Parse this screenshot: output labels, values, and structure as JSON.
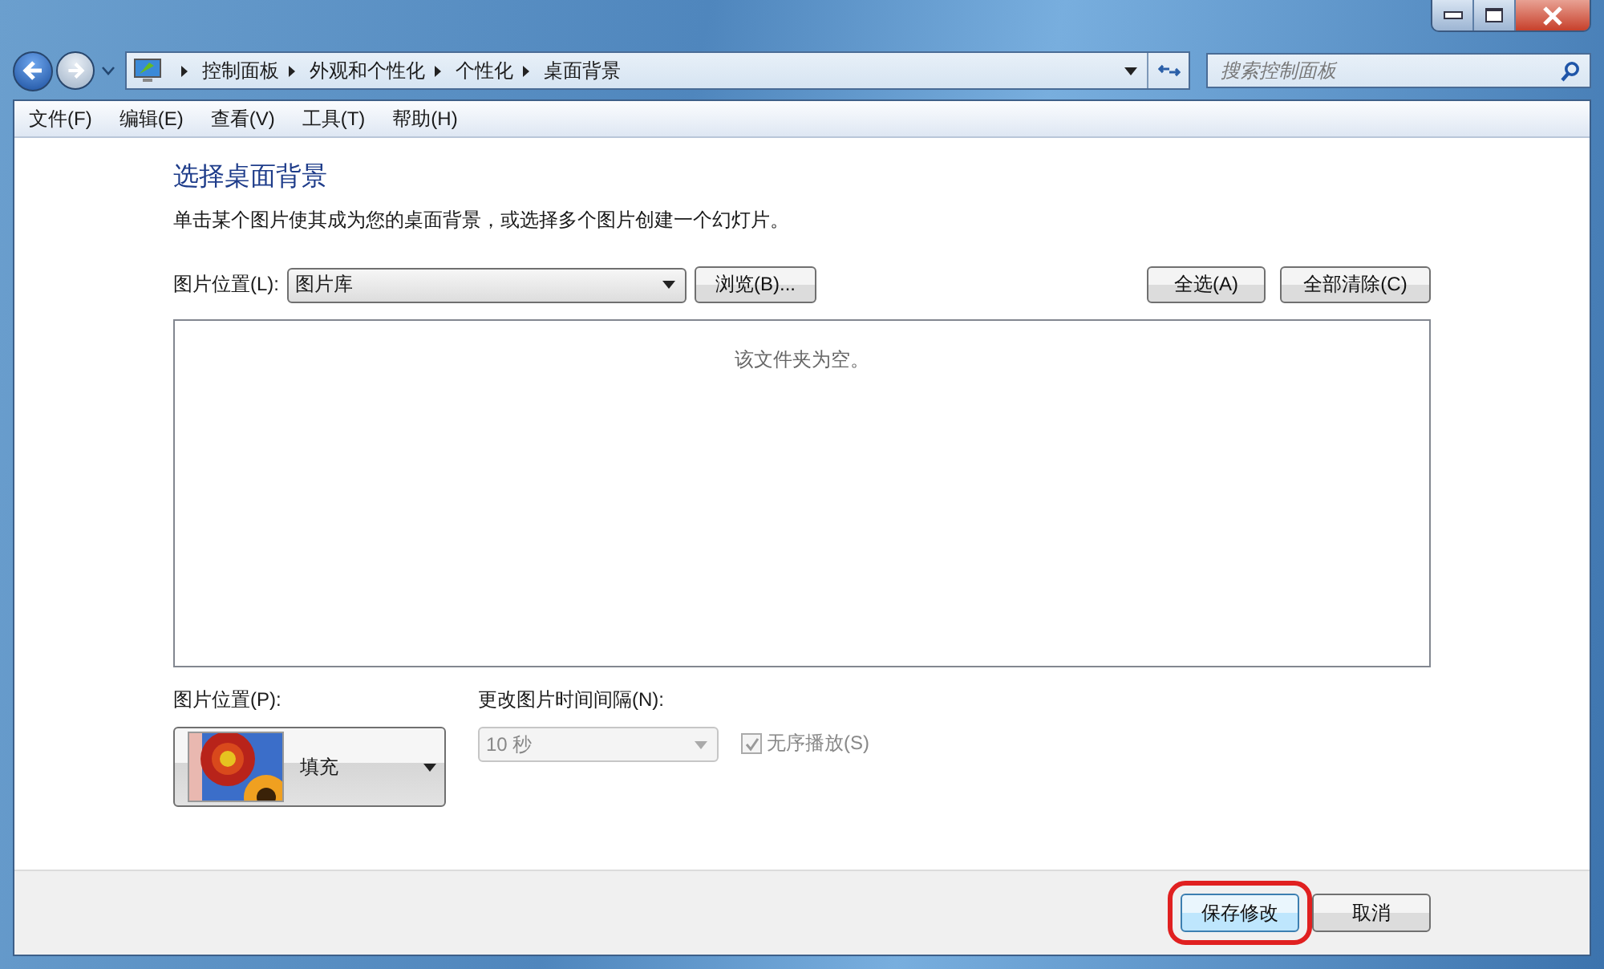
{
  "nav": {
    "breadcrumb": [
      "控制面板",
      "外观和个性化",
      "个性化",
      "桌面背景"
    ],
    "search": {
      "placeholder": "搜索控制面板"
    }
  },
  "menu": [
    "文件(F)",
    "编辑(E)",
    "查看(V)",
    "工具(T)",
    "帮助(H)"
  ],
  "heading": "选择桌面背景",
  "description": "单击某个图片使其成为您的桌面背景，或选择多个图片创建一个幻灯片。",
  "location": {
    "label": "图片位置(L):",
    "value": "图片库",
    "browse": "浏览(B)...",
    "select_all": "全选(A)",
    "clear_all": "全部清除(C)"
  },
  "gallery": {
    "empty_text": "该文件夹为空。"
  },
  "position": {
    "label": "图片位置(P):",
    "value": "填充"
  },
  "interval": {
    "label": "更改图片时间间隔(N):",
    "value": "10 秒",
    "disabled": true
  },
  "shuffle": {
    "label": "无序播放(S)",
    "checked": true,
    "disabled": true
  },
  "buttons": [
    {
      "label": "保存修改",
      "highlighted": true
    },
    {
      "label": "取消",
      "highlighted": false
    }
  ]
}
